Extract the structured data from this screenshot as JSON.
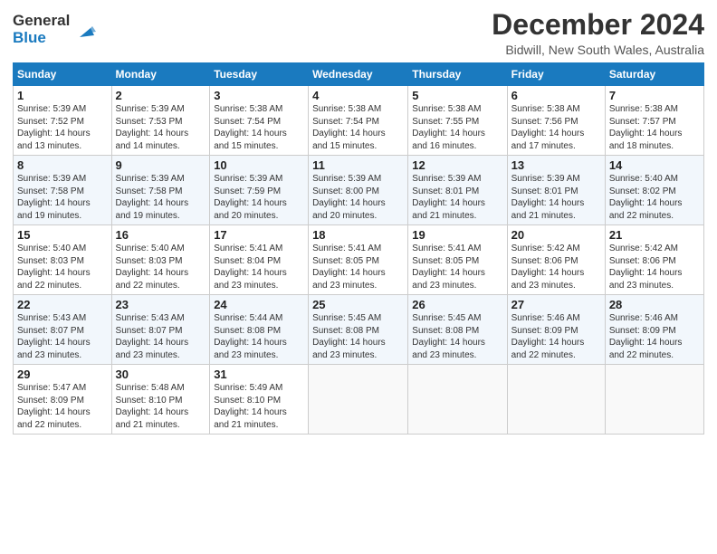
{
  "logo": {
    "general": "General",
    "blue": "Blue"
  },
  "title": {
    "month": "December 2024",
    "location": "Bidwill, New South Wales, Australia"
  },
  "weekdays": [
    "Sunday",
    "Monday",
    "Tuesday",
    "Wednesday",
    "Thursday",
    "Friday",
    "Saturday"
  ],
  "weeks": [
    [
      {
        "day": "1",
        "info": "Sunrise: 5:39 AM\nSunset: 7:52 PM\nDaylight: 14 hours\nand 13 minutes."
      },
      {
        "day": "2",
        "info": "Sunrise: 5:39 AM\nSunset: 7:53 PM\nDaylight: 14 hours\nand 14 minutes."
      },
      {
        "day": "3",
        "info": "Sunrise: 5:38 AM\nSunset: 7:54 PM\nDaylight: 14 hours\nand 15 minutes."
      },
      {
        "day": "4",
        "info": "Sunrise: 5:38 AM\nSunset: 7:54 PM\nDaylight: 14 hours\nand 15 minutes."
      },
      {
        "day": "5",
        "info": "Sunrise: 5:38 AM\nSunset: 7:55 PM\nDaylight: 14 hours\nand 16 minutes."
      },
      {
        "day": "6",
        "info": "Sunrise: 5:38 AM\nSunset: 7:56 PM\nDaylight: 14 hours\nand 17 minutes."
      },
      {
        "day": "7",
        "info": "Sunrise: 5:38 AM\nSunset: 7:57 PM\nDaylight: 14 hours\nand 18 minutes."
      }
    ],
    [
      {
        "day": "8",
        "info": "Sunrise: 5:39 AM\nSunset: 7:58 PM\nDaylight: 14 hours\nand 19 minutes."
      },
      {
        "day": "9",
        "info": "Sunrise: 5:39 AM\nSunset: 7:58 PM\nDaylight: 14 hours\nand 19 minutes."
      },
      {
        "day": "10",
        "info": "Sunrise: 5:39 AM\nSunset: 7:59 PM\nDaylight: 14 hours\nand 20 minutes."
      },
      {
        "day": "11",
        "info": "Sunrise: 5:39 AM\nSunset: 8:00 PM\nDaylight: 14 hours\nand 20 minutes."
      },
      {
        "day": "12",
        "info": "Sunrise: 5:39 AM\nSunset: 8:01 PM\nDaylight: 14 hours\nand 21 minutes."
      },
      {
        "day": "13",
        "info": "Sunrise: 5:39 AM\nSunset: 8:01 PM\nDaylight: 14 hours\nand 21 minutes."
      },
      {
        "day": "14",
        "info": "Sunrise: 5:40 AM\nSunset: 8:02 PM\nDaylight: 14 hours\nand 22 minutes."
      }
    ],
    [
      {
        "day": "15",
        "info": "Sunrise: 5:40 AM\nSunset: 8:03 PM\nDaylight: 14 hours\nand 22 minutes."
      },
      {
        "day": "16",
        "info": "Sunrise: 5:40 AM\nSunset: 8:03 PM\nDaylight: 14 hours\nand 22 minutes."
      },
      {
        "day": "17",
        "info": "Sunrise: 5:41 AM\nSunset: 8:04 PM\nDaylight: 14 hours\nand 23 minutes."
      },
      {
        "day": "18",
        "info": "Sunrise: 5:41 AM\nSunset: 8:05 PM\nDaylight: 14 hours\nand 23 minutes."
      },
      {
        "day": "19",
        "info": "Sunrise: 5:41 AM\nSunset: 8:05 PM\nDaylight: 14 hours\nand 23 minutes."
      },
      {
        "day": "20",
        "info": "Sunrise: 5:42 AM\nSunset: 8:06 PM\nDaylight: 14 hours\nand 23 minutes."
      },
      {
        "day": "21",
        "info": "Sunrise: 5:42 AM\nSunset: 8:06 PM\nDaylight: 14 hours\nand 23 minutes."
      }
    ],
    [
      {
        "day": "22",
        "info": "Sunrise: 5:43 AM\nSunset: 8:07 PM\nDaylight: 14 hours\nand 23 minutes."
      },
      {
        "day": "23",
        "info": "Sunrise: 5:43 AM\nSunset: 8:07 PM\nDaylight: 14 hours\nand 23 minutes."
      },
      {
        "day": "24",
        "info": "Sunrise: 5:44 AM\nSunset: 8:08 PM\nDaylight: 14 hours\nand 23 minutes."
      },
      {
        "day": "25",
        "info": "Sunrise: 5:45 AM\nSunset: 8:08 PM\nDaylight: 14 hours\nand 23 minutes."
      },
      {
        "day": "26",
        "info": "Sunrise: 5:45 AM\nSunset: 8:08 PM\nDaylight: 14 hours\nand 23 minutes."
      },
      {
        "day": "27",
        "info": "Sunrise: 5:46 AM\nSunset: 8:09 PM\nDaylight: 14 hours\nand 22 minutes."
      },
      {
        "day": "28",
        "info": "Sunrise: 5:46 AM\nSunset: 8:09 PM\nDaylight: 14 hours\nand 22 minutes."
      }
    ],
    [
      {
        "day": "29",
        "info": "Sunrise: 5:47 AM\nSunset: 8:09 PM\nDaylight: 14 hours\nand 22 minutes."
      },
      {
        "day": "30",
        "info": "Sunrise: 5:48 AM\nSunset: 8:10 PM\nDaylight: 14 hours\nand 21 minutes."
      },
      {
        "day": "31",
        "info": "Sunrise: 5:49 AM\nSunset: 8:10 PM\nDaylight: 14 hours\nand 21 minutes."
      },
      {
        "day": "",
        "info": ""
      },
      {
        "day": "",
        "info": ""
      },
      {
        "day": "",
        "info": ""
      },
      {
        "day": "",
        "info": ""
      }
    ]
  ]
}
